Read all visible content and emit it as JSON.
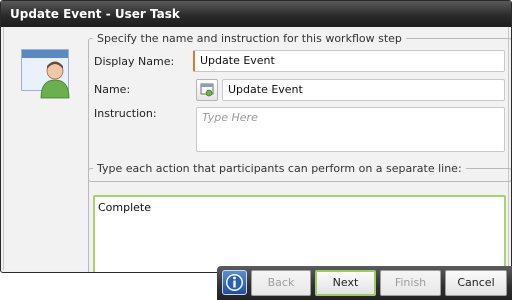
{
  "window": {
    "title": "Update Event - User Task"
  },
  "name_group": {
    "legend": "Specify the name and instruction for this workflow step",
    "display_name_label": "Display Name:",
    "display_name_value": "Update Event",
    "name_label": "Name:",
    "name_value": "Update Event",
    "instruction_label": "Instruction:",
    "instruction_placeholder": "Type Here"
  },
  "actions_group": {
    "legend": "Type each action that participants can perform on a separate line:",
    "value": "Complete"
  },
  "footer": {
    "back_label": "Back",
    "next_label": "Next",
    "finish_label": "Finish",
    "cancel_label": "Cancel"
  },
  "icons": {
    "dialog": "user-task-icon",
    "name_picker": "field-picker-icon",
    "help": "info-icon"
  },
  "colors": {
    "accent_green": "#9fc964",
    "active_field": "#e07b20",
    "titlebar": "#2b2b2b"
  }
}
